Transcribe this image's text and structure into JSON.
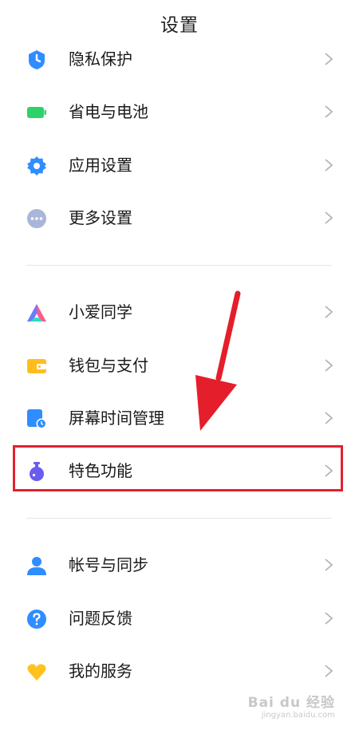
{
  "header": {
    "title": "设置"
  },
  "groups": [
    {
      "items": [
        {
          "label": "隐私保护",
          "icon": "shield-icon"
        },
        {
          "label": "省电与电池",
          "icon": "battery-icon"
        },
        {
          "label": "应用设置",
          "icon": "gear-icon"
        },
        {
          "label": "更多设置",
          "icon": "more-dots-icon"
        }
      ]
    },
    {
      "items": [
        {
          "label": "小爱同学",
          "icon": "xiaoai-icon"
        },
        {
          "label": "钱包与支付",
          "icon": "wallet-icon"
        },
        {
          "label": "屏幕时间管理",
          "icon": "screen-time-icon"
        },
        {
          "label": "特色功能",
          "icon": "flask-icon"
        }
      ]
    },
    {
      "items": [
        {
          "label": "帐号与同步",
          "icon": "account-icon"
        },
        {
          "label": "问题反馈",
          "icon": "question-icon"
        },
        {
          "label": "我的服务",
          "icon": "heart-icon"
        }
      ]
    }
  ],
  "annotation": {
    "highlight_color": "#e0222e",
    "highlighted_item": "特色功能"
  },
  "watermark": {
    "line1": "Bai du 经验",
    "line2": "jingyan.baidu.com"
  },
  "colors": {
    "shield": "#2f8dff",
    "battery": "#2fd16a",
    "gear": "#2f8dff",
    "more": "#a9b6d9",
    "wallet": "#ffbe1e",
    "screen": "#2f8dff",
    "flask": "#6b5cf0",
    "account": "#2f8dff",
    "question": "#2f8dff",
    "heart": "#ffc21f"
  }
}
